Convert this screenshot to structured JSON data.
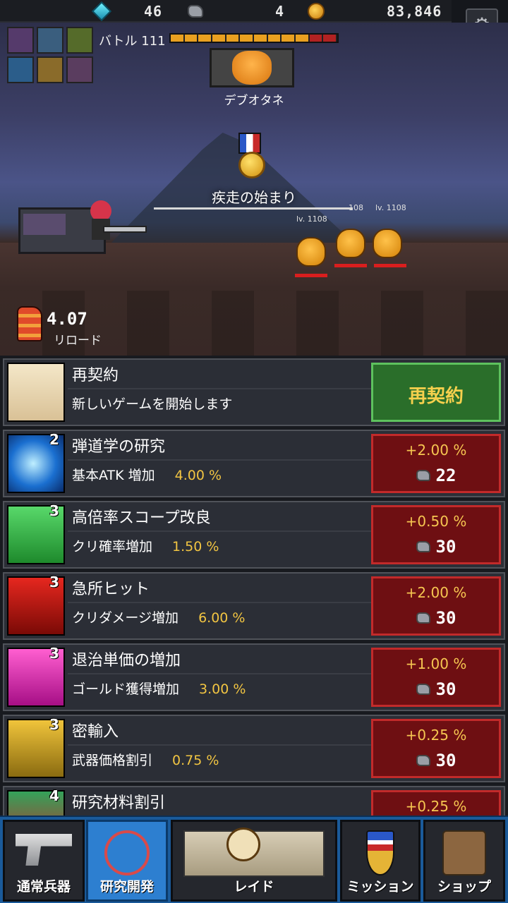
{
  "resources": {
    "gems": "46",
    "scrap": "4",
    "gold": "83,846"
  },
  "battle": {
    "label": "バトル 111",
    "hp_segments_filled": 10,
    "hp_segments_total": 12,
    "boss_name": "デブオタネ",
    "stage_title": "疾走の始まり",
    "enemy_level_1": "lv. 1108",
    "enemy_level_2": "108",
    "enemy_level_3": "lv. 1108",
    "reload_value": "4.07",
    "reload_label": "リロード"
  },
  "research": [
    {
      "title": "再契約",
      "desc": "新しいゲームを開始します",
      "button": "再契約",
      "type": "contract"
    },
    {
      "level": "2",
      "title": "弾道学の研究",
      "desc": "基本ATK 増加",
      "value": "4.00 %",
      "gain": "+2.00 %",
      "cost": "22"
    },
    {
      "level": "3",
      "title": "高倍率スコープ改良",
      "desc": "クリ確率増加",
      "value": "1.50 %",
      "gain": "+0.50 %",
      "cost": "30"
    },
    {
      "level": "3",
      "title": "急所ヒット",
      "desc": "クリダメージ増加",
      "value": "6.00 %",
      "gain": "+2.00 %",
      "cost": "30"
    },
    {
      "level": "3",
      "title": "退治単価の増加",
      "desc": "ゴールド獲得増加",
      "value": "3.00 %",
      "gain": "+1.00 %",
      "cost": "30"
    },
    {
      "level": "3",
      "title": "密輸入",
      "desc": "武器価格割引",
      "value": "0.75 %",
      "gain": "+0.25 %",
      "cost": "30"
    },
    {
      "level": "4",
      "title": "研究材料割引",
      "gain": "+0.25 %"
    }
  ],
  "nav": {
    "weapons": "通常兵器",
    "research": "研究開発",
    "raid": "レイド",
    "missions": "ミッション",
    "shop": "ショップ"
  }
}
